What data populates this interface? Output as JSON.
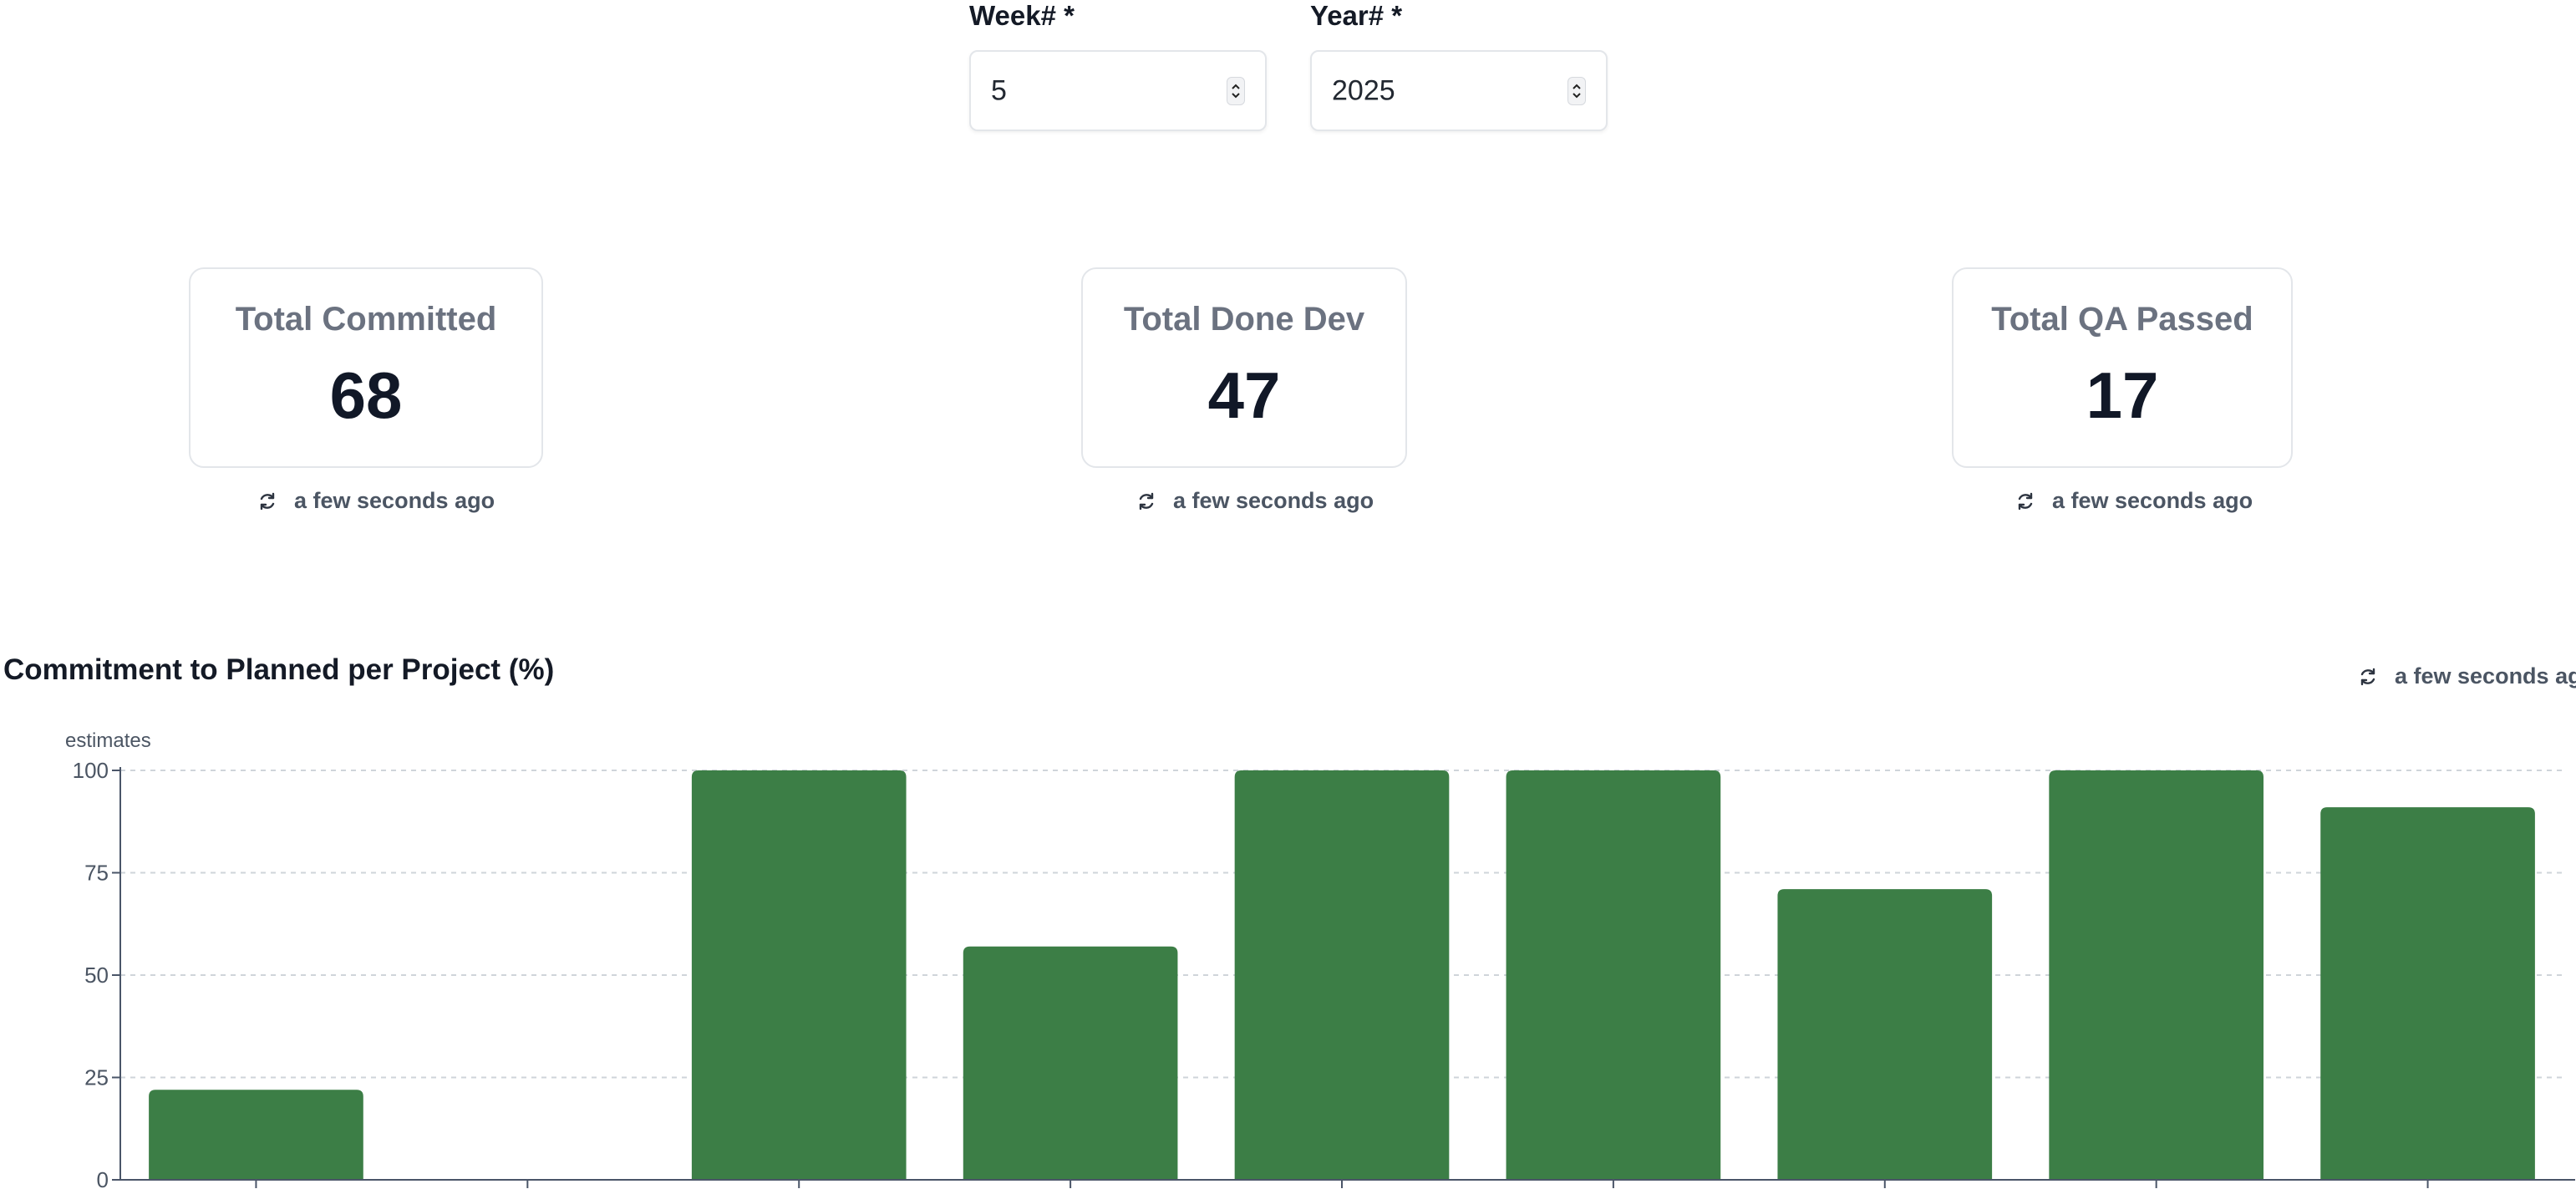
{
  "filters": {
    "week": {
      "label": "Week# *",
      "value": "5"
    },
    "year": {
      "label": "Year# *",
      "value": "2025"
    }
  },
  "kpis": [
    {
      "title": "Total Committed",
      "value": "68",
      "updated": "a few seconds ago"
    },
    {
      "title": "Total Done Dev",
      "value": "47",
      "updated": "a few seconds ago"
    },
    {
      "title": "Total QA Passed",
      "value": "17",
      "updated": "a few seconds ago"
    }
  ],
  "chart": {
    "title": "Commitment to Planned per Project (%)",
    "updated": "a few seconds ago"
  },
  "icons": {
    "refresh": "refresh-icon",
    "spinner": "chevron-up-down-icon"
  },
  "colors": {
    "bar": "#3c7e46",
    "axis": "#4a5568",
    "grid": "#cfd4da"
  },
  "chart_data": {
    "type": "bar",
    "title": "Commitment to Planned per Project (%)",
    "ylabel": "estimates",
    "xlabel": "",
    "ylim": [
      0,
      100
    ],
    "yticks": [
      0,
      25,
      50,
      75,
      100
    ],
    "grid": true,
    "values": [
      22,
      0,
      100,
      57,
      100,
      100,
      71,
      100,
      91
    ]
  }
}
